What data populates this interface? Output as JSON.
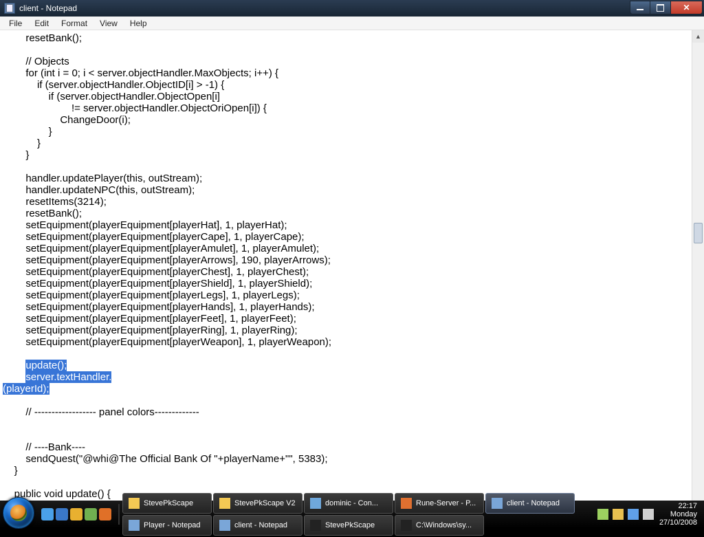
{
  "window": {
    "title": "client - Notepad"
  },
  "menu": {
    "file": "File",
    "edit": "Edit",
    "format": "Format",
    "view": "View",
    "help": "Help"
  },
  "code": {
    "pre": "        resetBank();\n\n        // Objects\n        for (int i = 0; i < server.objectHandler.MaxObjects; i++) {\n            if (server.objectHandler.ObjectID[i] > -1) {\n                if (server.objectHandler.ObjectOpen[i]\n                        != server.objectHandler.ObjectOriOpen[i]) {\n                    ChangeDoor(i);\n                }\n            }\n        }\n\n        handler.updatePlayer(this, outStream);\n        handler.updateNPC(this, outStream);\n        resetItems(3214);\n        resetBank();\n        setEquipment(playerEquipment[playerHat], 1, playerHat);\n        setEquipment(playerEquipment[playerCape], 1, playerCape);\n        setEquipment(playerEquipment[playerAmulet], 1, playerAmulet);\n        setEquipment(playerEquipment[playerArrows], 190, playerArrows);\n        setEquipment(playerEquipment[playerChest], 1, playerChest);\n        setEquipment(playerEquipment[playerShield], 1, playerShield);\n        setEquipment(playerEquipment[playerLegs], 1, playerLegs);\n        setEquipment(playerEquipment[playerHands], 1, playerHands);\n        setEquipment(playerEquipment[playerFeet], 1, playerFeet);\n        setEquipment(playerEquipment[playerRing], 1, playerRing);\n        setEquipment(playerEquipment[playerWeapon], 1, playerWeapon);\n\n",
    "sel1_pad": "        ",
    "sel1": "update();",
    "sel2_pad": "        ",
    "sel2": "server.textHandler.",
    "sel3": "(playerId);",
    "post": "\n\n        // ------------------ panel colors-------------\n\n\n        // ----Bank----\n        sendQuest(\"@whi@The Official Bank Of \"+playerName+\"\", 5383);\n    }\n\n    public void update() {"
  },
  "taskbar": {
    "row1": [
      {
        "label": "StevePkScape",
        "iconColor": "#f4c954"
      },
      {
        "label": "StevePkScape V2",
        "iconColor": "#f4c954"
      },
      {
        "label": "dominic - Con...",
        "iconColor": "#6fa8dc"
      },
      {
        "label": "Rune-Server - P...",
        "iconColor": "#e07030"
      },
      {
        "label": "client - Notepad",
        "iconColor": "#7aa6d8",
        "active": true
      }
    ],
    "row2": [
      {
        "label": "Player - Notepad",
        "iconColor": "#7aa6d8"
      },
      {
        "label": "client - Notepad",
        "iconColor": "#7aa6d8"
      },
      {
        "label": "StevePkScape",
        "iconColor": "#222222"
      },
      {
        "label": "C:\\Windows\\sy...",
        "iconColor": "#222222"
      }
    ]
  },
  "quicklaunch": [
    {
      "name": "safari",
      "color": "#4aa0e8"
    },
    {
      "name": "ie",
      "color": "#3a78c8"
    },
    {
      "name": "chrome",
      "color": "#e8b030"
    },
    {
      "name": "tool",
      "color": "#70b050"
    },
    {
      "name": "firefox",
      "color": "#e07028"
    }
  ],
  "tray": {
    "icons": [
      {
        "name": "user",
        "color": "#9cd060"
      },
      {
        "name": "battery",
        "color": "#e8c050"
      },
      {
        "name": "msn",
        "color": "#60a0e8"
      },
      {
        "name": "volume",
        "color": "#d0d0d0"
      }
    ],
    "time": "22:17",
    "day": "Monday",
    "date": "27/10/2008"
  }
}
